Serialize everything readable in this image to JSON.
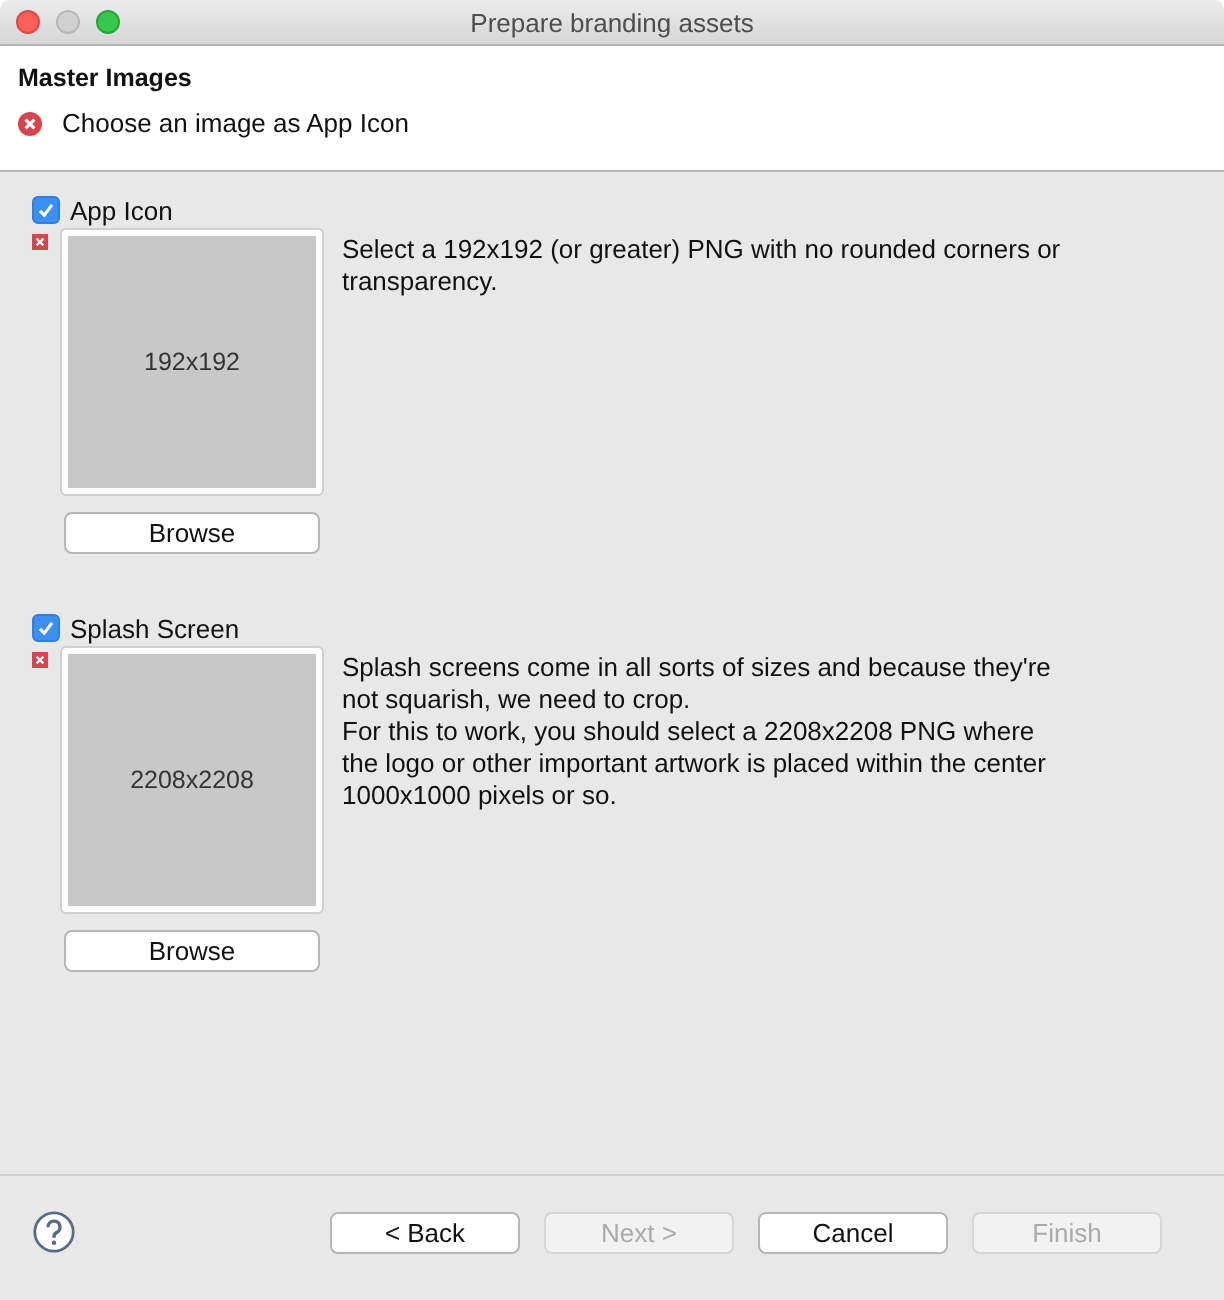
{
  "window": {
    "title": "Prepare branding assets"
  },
  "header": {
    "title": "Master Images",
    "error": "Choose an image as App Icon"
  },
  "sections": [
    {
      "label": "App Icon",
      "checked": true,
      "error": true,
      "image_label": "192x192",
      "browse": "Browse",
      "description": [
        "Select a 192x192 (or greater) PNG with no rounded corners or transparency."
      ]
    },
    {
      "label": "Splash Screen",
      "checked": true,
      "error": true,
      "image_label": "2208x2208",
      "browse": "Browse",
      "description": [
        "Splash screens come in all sorts of sizes and because they're not squarish, we need to crop.",
        "For this to work, you should select a 2208x2208 PNG where the logo or other important artwork is placed within the center 1000x1000 pixels or so."
      ]
    }
  ],
  "buttons": [
    {
      "label": "< Back",
      "disabled": false
    },
    {
      "label": "Next >",
      "disabled": true
    },
    {
      "label": "Cancel",
      "disabled": false
    },
    {
      "label": "Finish",
      "disabled": true
    }
  ]
}
